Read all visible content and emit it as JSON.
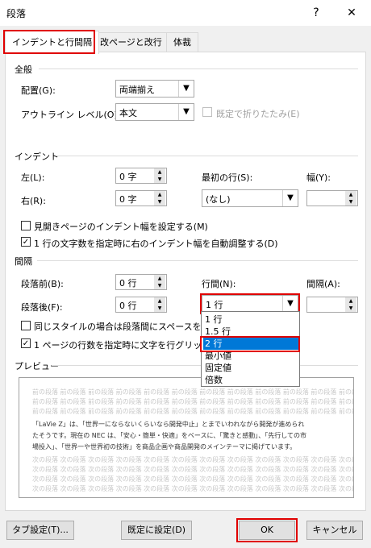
{
  "window": {
    "title": "段落",
    "help_glyph": "?",
    "close_glyph": "✕"
  },
  "tabs": [
    {
      "label": "インデントと行間隔"
    },
    {
      "label": "改ページと改行"
    },
    {
      "label": "体裁"
    }
  ],
  "general": {
    "heading": "全般",
    "alignment_label": "配置(G):",
    "alignment_value": "両端揃え",
    "outline_label": "アウトライン レベル(O):",
    "outline_value": "本文",
    "collapsed_label": "既定で折りたたみ(E)"
  },
  "indent": {
    "heading": "インデント",
    "left_label": "左(L):",
    "left_value": "0 字",
    "right_label": "右(R):",
    "right_value": "0 字",
    "first_line_label": "最初の行(S):",
    "first_line_value": "(なし)",
    "width_label": "幅(Y):",
    "mirror_label": "見開きページのインデント幅を設定する(M)",
    "auto_adjust_label": "1 行の文字数を指定時に右のインデント幅を自動調整する(D)"
  },
  "spacing": {
    "heading": "間隔",
    "before_label": "段落前(B):",
    "before_value": "0 行",
    "after_label": "段落後(F):",
    "after_value": "0 行",
    "line_spacing_label": "行間(N):",
    "line_spacing_value": "1 行",
    "at_label": "間隔(A):",
    "dont_add_label": "同じスタイルの場合は段落間にスペースを追加",
    "snap_grid_label": "1 ページの行数を指定時に文字を行グリッド",
    "dropdown_options": [
      "1 行",
      "1.5 行",
      "2 行",
      "最小値",
      "固定値",
      "倍数"
    ]
  },
  "preview": {
    "heading": "プレビュー",
    "prev_line": "前の段落 前の段落 前の段落 前の段落 前の段落 前の段落 前の段落 前の段落 前の段落 前の段落 前の段落 前の段落 前の段落",
    "sample_lines": [
      "「LaVie Z」は、「世界一にならないくらいなら開発中止」とまでいわれながら開発が進められ",
      "たそうです。現在の NEC は、「安心・簡単・快適」をベースに、「驚きと感動」、「先行しての市",
      "場投入」、「世界一や世界初の技術」を商品企画や商品開発のメインテーマに掲げています。"
    ],
    "next_line": "次の段落 次の段落 次の段落 次の段落 次の段落 次の段落 次の段落 次の段落 次の段落 次の段落 次の段落 次の段落 次の段落"
  },
  "buttons": {
    "tabs": "タブ設定(T)...",
    "default": "既定に設定(D)",
    "ok": "OK",
    "cancel": "キャンセル"
  }
}
